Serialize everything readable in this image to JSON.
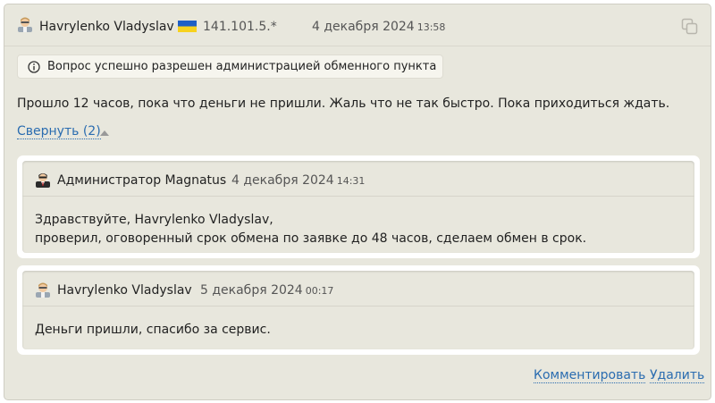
{
  "comment": {
    "author": "Havrylenko Vladyslav",
    "ip": "141.101.5.*",
    "date": "4 декабря 2024",
    "time": "13:58",
    "notice": "Вопрос успешно разрешен администрацией обменного пункта",
    "message": "Прошло 12 часов, пока что деньги не пришли. Жаль что не так быстро. Пока приходиться ждать.",
    "collapse_label": "Свернуть (2)"
  },
  "replies": [
    {
      "author": "Администратор Magnatus",
      "date": "4 декабря 2024",
      "time": "14:31",
      "lines": [
        "Здравствуйте, Havrylenko Vladyslav,",
        "проверил, оговоренный срок обмена по заявке до 48 часов, сделаем обмен в срок."
      ]
    },
    {
      "author": "Havrylenko Vladyslav",
      "date": "5 декабря 2024",
      "time": "00:17",
      "lines": [
        "Деньги пришли, спасибо за сервис."
      ]
    }
  ],
  "actions": {
    "comment_label": "Комментировать",
    "delete_label": "Удалить"
  },
  "colors": {
    "card_bg": "#e8e7dd",
    "link": "#2a6cb0",
    "flag_blue": "#1f5fc5",
    "flag_yellow": "#f7d21e"
  }
}
